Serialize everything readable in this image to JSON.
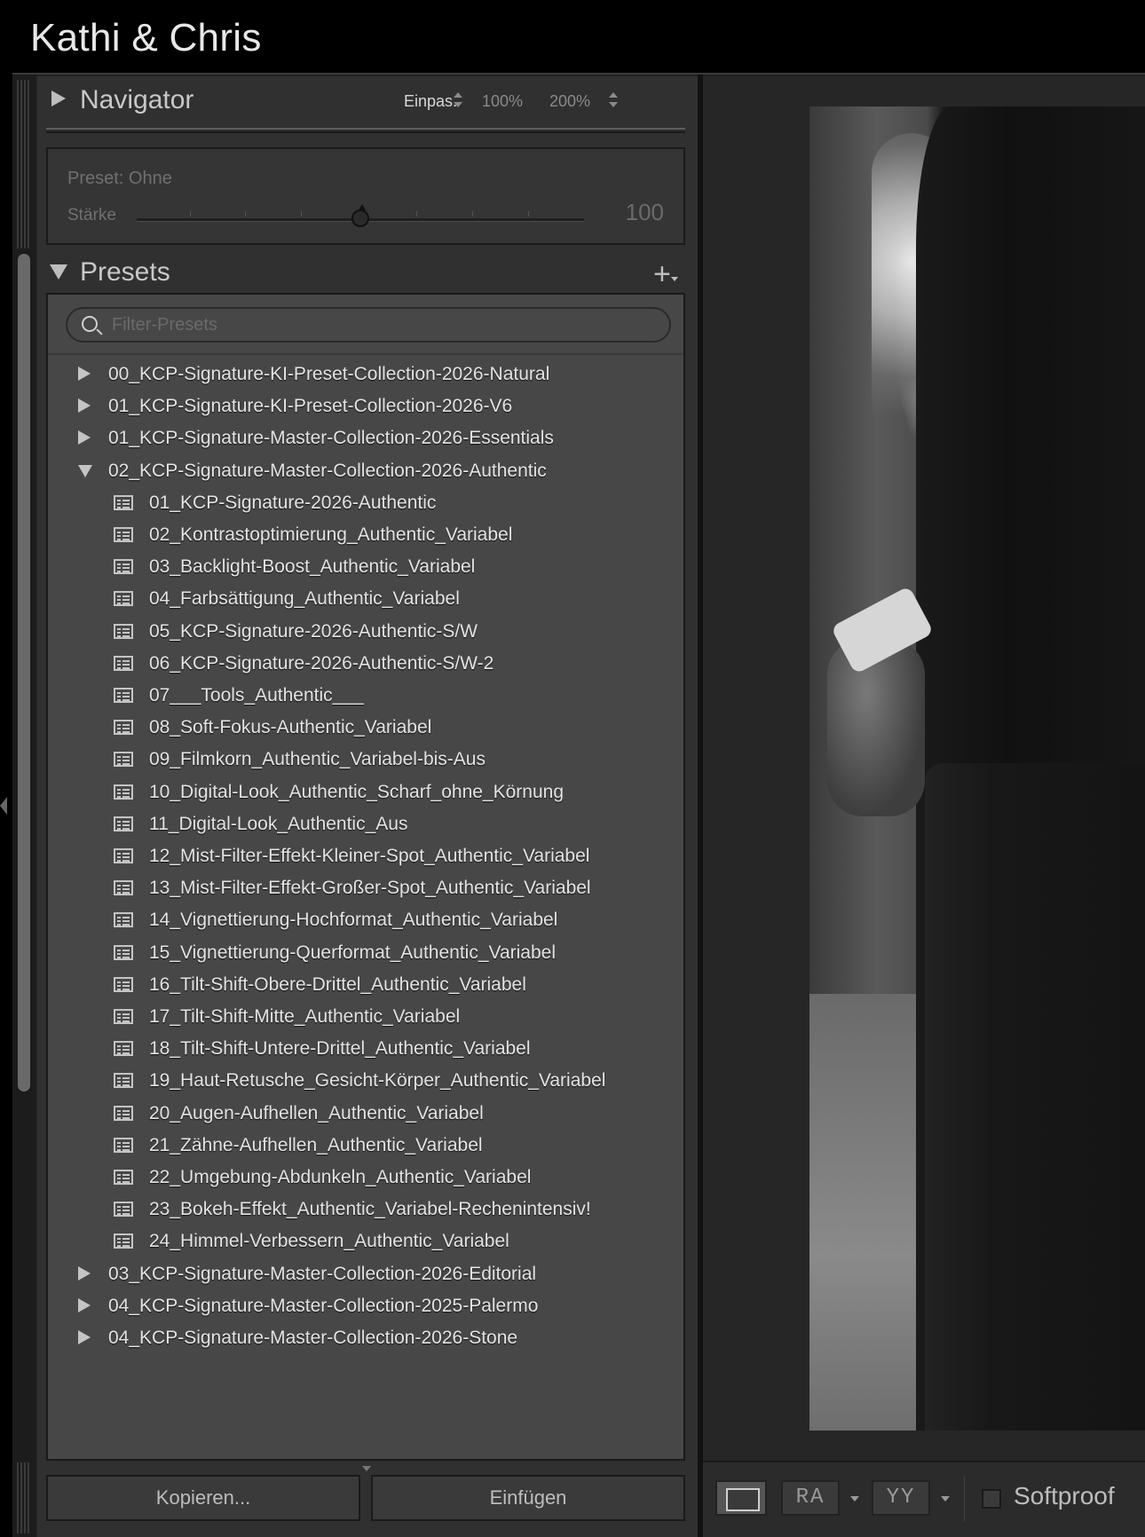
{
  "app": {
    "title": "Kathi & Chris"
  },
  "navigator": {
    "title": "Navigator",
    "zoom_options": [
      "Einpas.",
      "100%",
      "200%"
    ],
    "zoom_selected": "Einpas."
  },
  "strength": {
    "preset_label": "Preset: Ohne",
    "label": "Stärke",
    "value": "100",
    "level_fraction": 0.5
  },
  "presets": {
    "title": "Presets",
    "search_placeholder": "Filter-Presets",
    "groups": [
      {
        "label": "00_KCP-Signature-KI-Preset-Collection-2026-Natural",
        "expanded": false,
        "items": []
      },
      {
        "label": "01_KCP-Signature-KI-Preset-Collection-2026-V6",
        "expanded": false,
        "items": []
      },
      {
        "label": "01_KCP-Signature-Master-Collection-2026-Essentials",
        "expanded": false,
        "items": []
      },
      {
        "label": "02_KCP-Signature-Master-Collection-2026-Authentic",
        "expanded": true,
        "items": [
          "01_KCP-Signature-2026-Authentic",
          "02_Kontrastoptimierung_Authentic_Variabel",
          "03_Backlight-Boost_Authentic_Variabel",
          "04_Farbsättigung_Authentic_Variabel",
          "05_KCP-Signature-2026-Authentic-S/W",
          "06_KCP-Signature-2026-Authentic-S/W-2",
          "07___Tools_Authentic___",
          "08_Soft-Fokus-Authentic_Variabel",
          "09_Filmkorn_Authentic_Variabel-bis-Aus",
          "10_Digital-Look_Authentic_Scharf_ohne_Körnung",
          "11_Digital-Look_Authentic_Aus",
          "12_Mist-Filter-Effekt-Kleiner-Spot_Authentic_Variabel",
          "13_Mist-Filter-Effekt-Großer-Spot_Authentic_Variabel",
          "14_Vignettierung-Hochformat_Authentic_Variabel",
          "15_Vignettierung-Querformat_Authentic_Variabel",
          "16_Tilt-Shift-Obere-Drittel_Authentic_Variabel",
          "17_Tilt-Shift-Mitte_Authentic_Variabel",
          "18_Tilt-Shift-Untere-Drittel_Authentic_Variabel",
          "19_Haut-Retusche_Gesicht-Körper_Authentic_Variabel",
          "20_Augen-Aufhellen_Authentic_Variabel",
          "21_Zähne-Aufhellen_Authentic_Variabel",
          "22_Umgebung-Abdunkeln_Authentic_Variabel",
          "23_Bokeh-Effekt_Authentic_Variabel-Rechenintensiv!",
          "24_Himmel-Verbessern_Authentic_Variabel"
        ]
      },
      {
        "label": "03_KCP-Signature-Master-Collection-2026-Editorial",
        "expanded": false,
        "items": []
      },
      {
        "label": "04_KCP-Signature-Master-Collection-2025-Palermo",
        "expanded": false,
        "items": []
      },
      {
        "label": "04_KCP-Signature-Master-Collection-2026-Stone",
        "expanded": false,
        "items": []
      }
    ]
  },
  "buttons": {
    "copy": "Kopieren...",
    "paste": "Einfügen"
  },
  "toolbar": {
    "ra_label": "RA",
    "yy_label": "YY",
    "softproof_label": "Softproof",
    "softproof_checked": false
  }
}
